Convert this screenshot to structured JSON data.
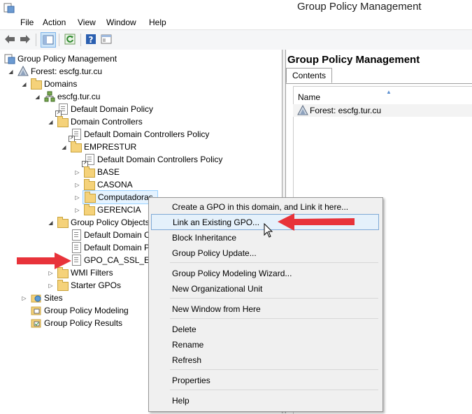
{
  "window": {
    "title": "Group Policy Management"
  },
  "menu": [
    "File",
    "Action",
    "View",
    "Window",
    "Help"
  ],
  "tree": [
    {
      "label": "Group Policy Management",
      "icon": "gpm-icon"
    },
    {
      "label": "Forest: escfg.tur.cu",
      "icon": "forest-icon"
    },
    {
      "label": "Domains",
      "icon": "folder-icon"
    },
    {
      "label": "escfg.tur.cu",
      "icon": "domain-icon"
    },
    {
      "label": "Default Domain Policy",
      "icon": "gpo-link-icon"
    },
    {
      "label": "Domain Controllers",
      "icon": "folder-icon"
    },
    {
      "label": "Default Domain Controllers Policy",
      "icon": "gpo-link-icon"
    },
    {
      "label": "EMPRESTUR",
      "icon": "folder-icon"
    },
    {
      "label": "Default Domain Controllers Policy",
      "icon": "gpo-link-icon"
    },
    {
      "label": "BASE",
      "icon": "folder-icon"
    },
    {
      "label": "CASONA",
      "icon": "folder-icon"
    },
    {
      "label": "Computadoras",
      "icon": "folder-icon"
    },
    {
      "label": "GERENCIA",
      "icon": "folder-icon"
    },
    {
      "label": "Group Policy Objects",
      "icon": "folder-icon"
    },
    {
      "label": "Default Domain C",
      "icon": "gpo-icon"
    },
    {
      "label": "Default Domain P",
      "icon": "gpo-icon"
    },
    {
      "label": "GPO_CA_SSL_ESC",
      "icon": "gpo-icon"
    },
    {
      "label": "WMI Filters",
      "icon": "folder-icon"
    },
    {
      "label": "Starter GPOs",
      "icon": "folder-icon"
    },
    {
      "label": "Sites",
      "icon": "sites-icon"
    },
    {
      "label": "Group Policy Modeling",
      "icon": "modeling-icon"
    },
    {
      "label": "Group Policy Results",
      "icon": "results-icon"
    }
  ],
  "right": {
    "title": "Group Policy Management",
    "tab": "Contents",
    "column": "Name",
    "rows": [
      "Forest: escfg.tur.cu"
    ]
  },
  "context_menu": [
    "Create a GPO in this domain, and Link it here...",
    "Link an Existing GPO...",
    "Block Inheritance",
    "Group Policy Update...",
    "Group Policy Modeling Wizard...",
    "New Organizational Unit",
    "New Window from Here",
    "Delete",
    "Rename",
    "Refresh",
    "Properties",
    "Help"
  ],
  "colors": {
    "annotation_arrow": "#e8333a",
    "highlight": "#e5f1fb"
  }
}
